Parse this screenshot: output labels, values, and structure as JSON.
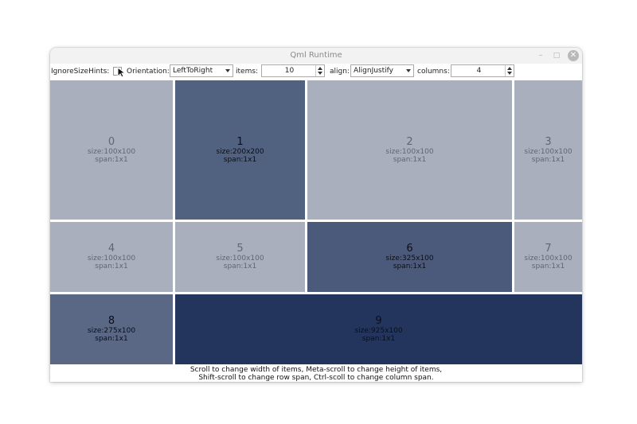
{
  "window": {
    "title": "Qml Runtime",
    "controls": {
      "minimize": "–",
      "maximize": "□",
      "close": "✕"
    }
  },
  "toolbar": {
    "ignore_size_hints_label": "IgnoreSizeHints:",
    "ignore_size_hints_checked": false,
    "orientation_label": "Orientation:",
    "orientation_value": "LeftToRight",
    "items_label": "items:",
    "items_value": "10",
    "align_label": "align:",
    "align_value": "AlignJustify",
    "columns_label": "columns:",
    "columns_value": "4"
  },
  "items": [
    {
      "index": "0",
      "size": "size:100x100",
      "span": "span:1x1",
      "style": "light"
    },
    {
      "index": "1",
      "size": "size:200x200",
      "span": "span:1x1",
      "style": "dark1"
    },
    {
      "index": "2",
      "size": "size:100x100",
      "span": "span:1x1",
      "style": "light"
    },
    {
      "index": "3",
      "size": "size:100x100",
      "span": "span:1x1",
      "style": "light"
    },
    {
      "index": "4",
      "size": "size:100x100",
      "span": "span:1x1",
      "style": "light"
    },
    {
      "index": "5",
      "size": "size:100x100",
      "span": "span:1x1",
      "style": "light"
    },
    {
      "index": "6",
      "size": "size:325x100",
      "span": "span:1x1",
      "style": "dark2"
    },
    {
      "index": "7",
      "size": "size:100x100",
      "span": "span:1x1",
      "style": "light"
    },
    {
      "index": "8",
      "size": "size:275x100",
      "span": "span:1x1",
      "style": "dark3"
    },
    {
      "index": "9",
      "size": "size:925x100",
      "span": "span:1x1",
      "style": "dark4"
    }
  ],
  "footer": {
    "line1": "Scroll to change width of items, Meta-scroll to change height of items,",
    "line2": "Shift-scroll to change row span, Ctrl-scoll to change column span."
  }
}
